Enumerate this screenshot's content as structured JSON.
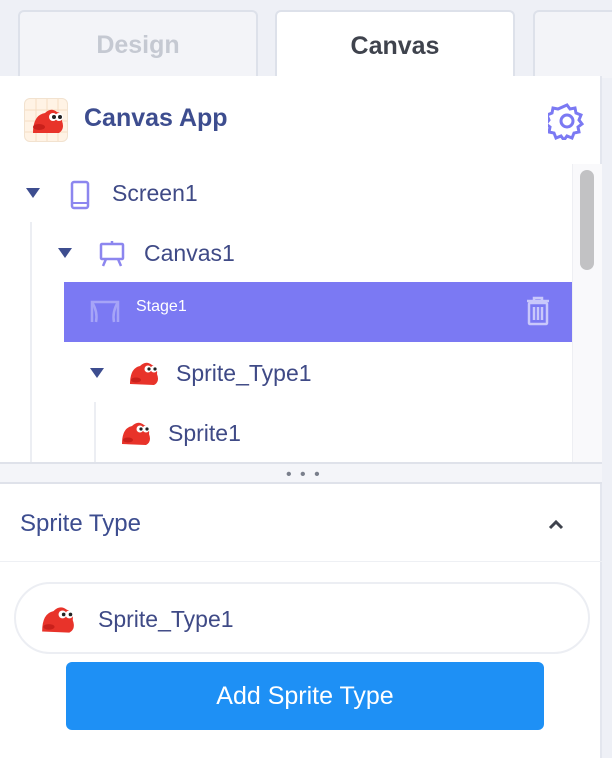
{
  "tabs": [
    {
      "label": "Design",
      "active": false
    },
    {
      "label": "Canvas",
      "active": true
    },
    {
      "label": "",
      "active": false
    }
  ],
  "app": {
    "title": "Canvas App",
    "icon": "mascot-icon"
  },
  "settings": {
    "icon": "gear-icon"
  },
  "tree": {
    "items": [
      {
        "label": "Screen1",
        "icon": "phone-icon",
        "expanded": true
      },
      {
        "label": "Canvas1",
        "icon": "easel-icon",
        "expanded": true
      },
      {
        "label": "Stage1",
        "icon": "stage-icon",
        "selected": true
      },
      {
        "label": "Sprite_Type1",
        "icon": "mascot-icon",
        "expanded": true
      },
      {
        "label": "Sprite1",
        "icon": "mascot-icon"
      }
    ],
    "delete_icon": "trash-icon"
  },
  "splitter": {
    "label": "• • •"
  },
  "sprite_type": {
    "title": "Sprite Type",
    "items": [
      {
        "label": "Sprite_Type1",
        "icon": "mascot-icon"
      }
    ],
    "add_button_label": "Add Sprite Type"
  },
  "colors": {
    "accent": "#1e90f5",
    "selected_row": "#7b79f3",
    "text_primary": "#3d4d8f"
  }
}
